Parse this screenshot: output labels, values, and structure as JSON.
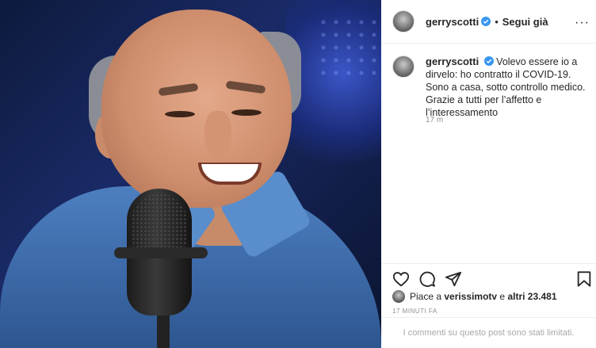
{
  "post": {
    "username": "gerryscotti",
    "separator": "•",
    "follow_label": "Segui già",
    "more_label": "···",
    "caption_username": "gerryscotti",
    "caption_text": "Volevo essere io a dirvelo: ho contratto il COVID-19. Sono a casa, sotto controllo medico. Grazie a tutti per l’affetto e l’interessamento",
    "caption_age": "17 m",
    "likes_prefix": "Piace a",
    "likes_user": "verissimotv",
    "likes_mid": "e",
    "likes_others": "altri 23.481",
    "timestamp": "17 MINUTI FA",
    "comments_limited": "I commenti su questo post sono stati limitati."
  },
  "icons": {
    "like": "heart-icon",
    "comment": "comment-icon",
    "share": "share-icon",
    "save": "bookmark-icon",
    "verified": "verified-badge-icon",
    "more": "more-options-icon"
  },
  "colors": {
    "verified": "#3897f0",
    "text": "#262626",
    "muted": "#8e8e8e"
  }
}
